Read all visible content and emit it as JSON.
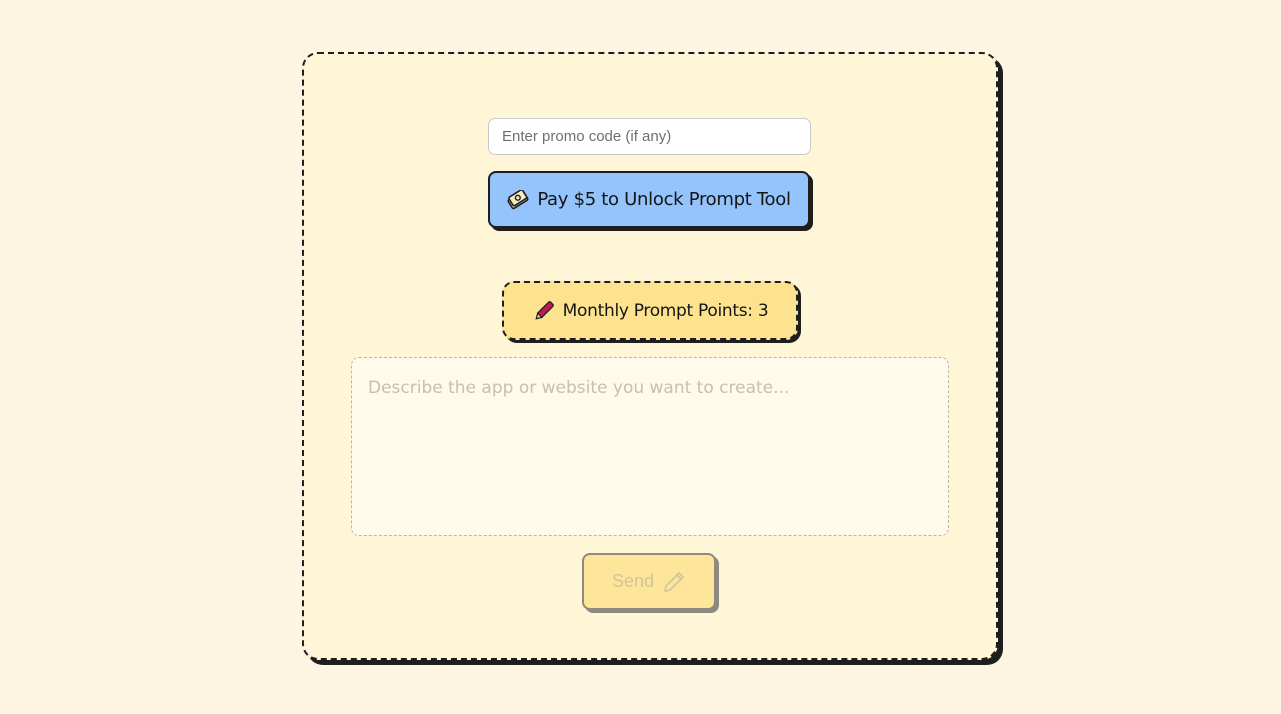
{
  "promo": {
    "placeholder": "Enter promo code (if any)",
    "value": ""
  },
  "pay_button": {
    "label": "Pay $5 to Unlock Prompt Tool",
    "icon": "money-icon"
  },
  "points": {
    "label": "Monthly Prompt Points: 3",
    "icon": "pencil-icon"
  },
  "prompt": {
    "placeholder": "Describe the app or website you want to create...",
    "value": ""
  },
  "send_button": {
    "label": "Send",
    "icon": "pencil-outline-icon",
    "disabled": true
  },
  "colors": {
    "page_background": "#fdf5e2",
    "card_background": "#fff6d8",
    "pay_button": "#94c4fb",
    "points_badge": "#fde28f",
    "send_button": "#fde69a",
    "pencil": "#c2185b"
  }
}
